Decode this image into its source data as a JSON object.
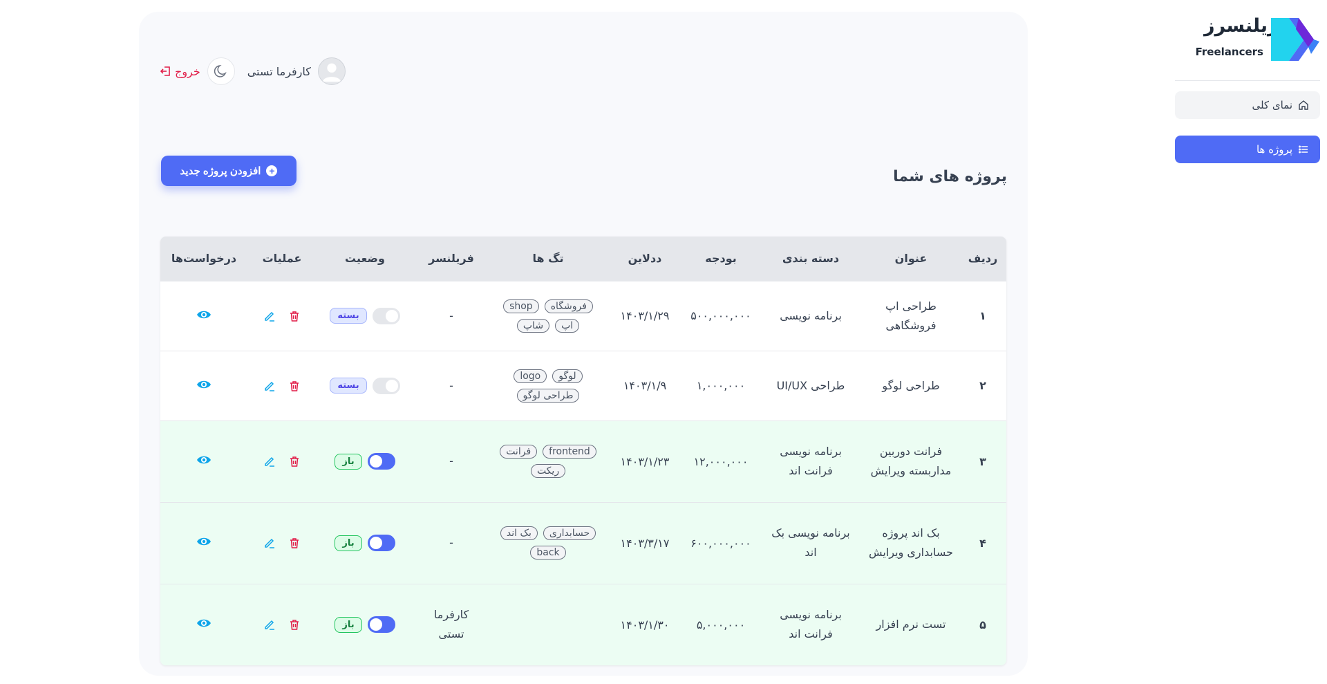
{
  "brand": {
    "name_fa": "فریلنسرز",
    "name_en": "Freelancers",
    "colors": {
      "primary": "#4f6bf5",
      "cyan": "#22d3ee",
      "purple": "#6d28d9"
    }
  },
  "sidebar": {
    "items": [
      {
        "label": "نمای کلی",
        "icon": "home-icon",
        "active": false
      },
      {
        "label": "پروژه ها",
        "icon": "list-icon",
        "active": true
      }
    ]
  },
  "header": {
    "user_name": "کارفرما تستی",
    "logout_label": "خروج"
  },
  "main": {
    "title": "پروژه های شما",
    "add_button_label": "افزودن پروژه جدید"
  },
  "table": {
    "columns": [
      "ردیف",
      "عنوان",
      "دسته بندی",
      "بودجه",
      "ددلاین",
      "تگ ها",
      "فریلنسر",
      "وضعیت",
      "عملیات",
      "درخواست‌ها"
    ],
    "rows": [
      {
        "index": "۱",
        "title": "طراحی اپ فروشگاهی",
        "category": "برنامه نویسی",
        "budget": "۵۰۰,۰۰۰,۰۰۰",
        "deadline": "۱۴۰۳/۱/۲۹",
        "tags": [
          "فروشگاه",
          "shop",
          "اپ",
          "شاپ"
        ],
        "freelancer": "-",
        "status": "بسته",
        "open": false
      },
      {
        "index": "۲",
        "title": "طراحی لوگو",
        "category": "طراحی UI/UX",
        "budget": "۱,۰۰۰,۰۰۰",
        "deadline": "۱۴۰۳/۱/۹",
        "tags": [
          "لوگو",
          "logo",
          "طراحی لوگو"
        ],
        "freelancer": "-",
        "status": "بسته",
        "open": false
      },
      {
        "index": "۳",
        "title": "فرانت دوربین مداربسته ویرایش",
        "category": "برنامه نویسی فرانت اند",
        "budget": "۱۲,۰۰۰,۰۰۰",
        "deadline": "۱۴۰۳/۱/۲۳",
        "tags": [
          "frontend",
          "فرانت",
          "ریکت"
        ],
        "freelancer": "-",
        "status": "باز",
        "open": true
      },
      {
        "index": "۴",
        "title": "بک اند پروژه حسابداری ویرایش",
        "category": "برنامه نویسی بک اند",
        "budget": "۶۰۰,۰۰۰,۰۰۰",
        "deadline": "۱۴۰۳/۳/۱۷",
        "tags": [
          "حسابداری",
          "بک اند",
          "back"
        ],
        "freelancer": "-",
        "status": "باز",
        "open": true
      },
      {
        "index": "۵",
        "title": "تست نرم افزار",
        "category": "برنامه نویسی فرانت اند",
        "budget": "۵,۰۰۰,۰۰۰",
        "deadline": "۱۴۰۳/۱/۳۰",
        "tags": [],
        "freelancer": "کارفرما تستی",
        "status": "باز",
        "open": true
      }
    ]
  }
}
